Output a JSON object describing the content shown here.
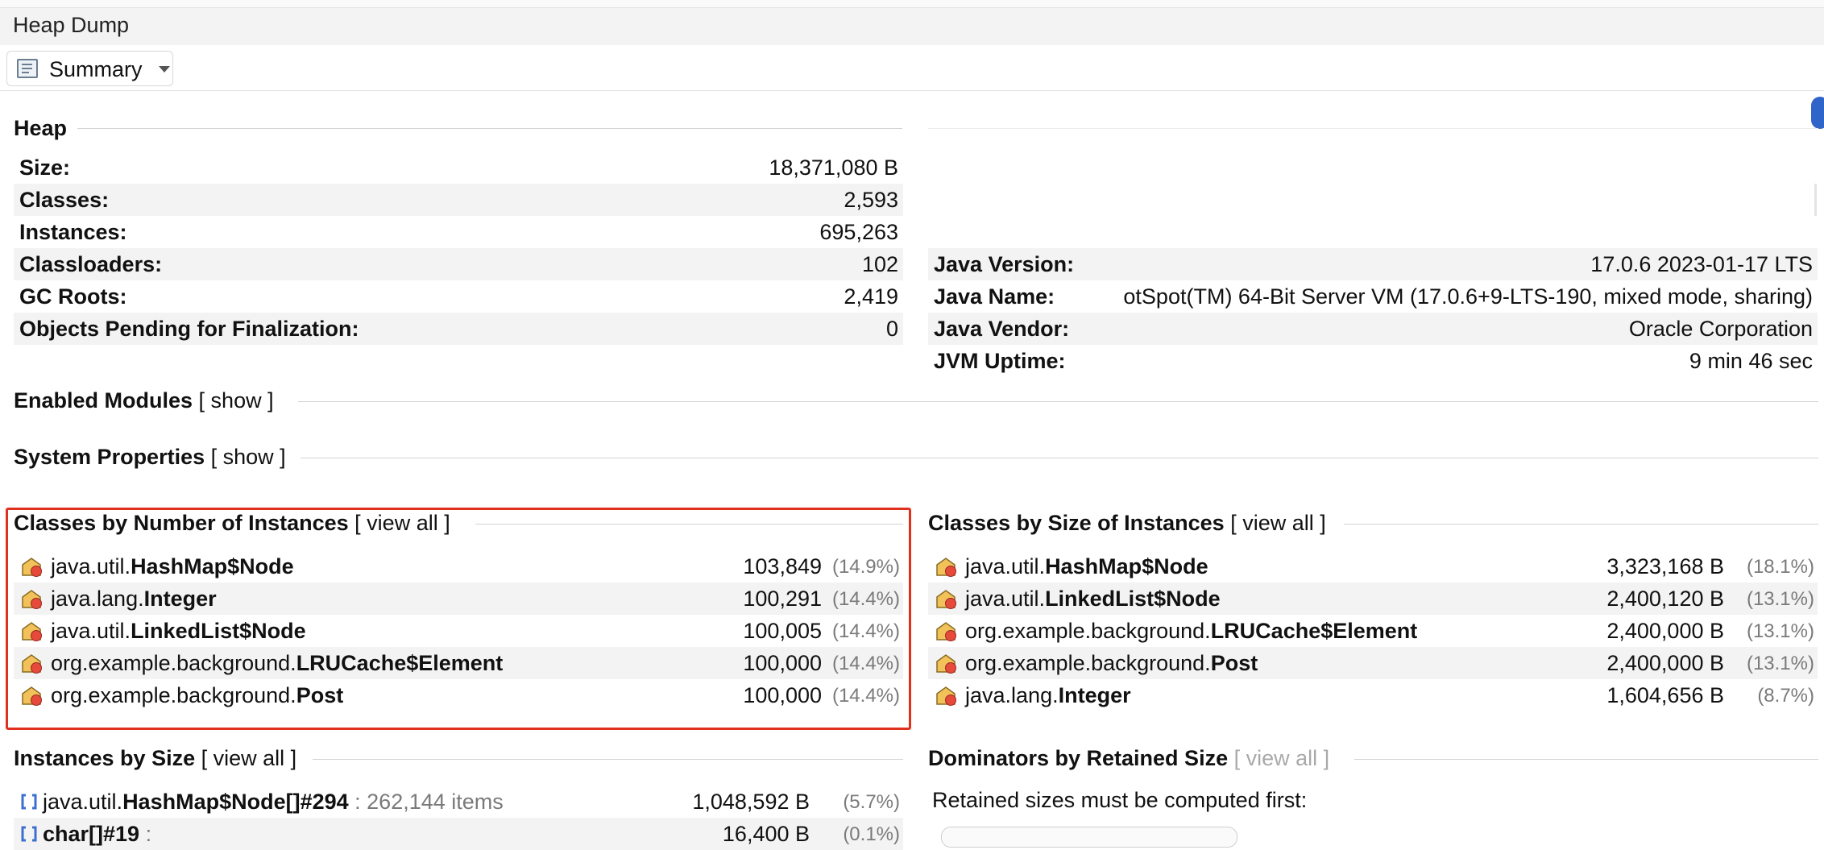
{
  "window": {
    "title": "Heap Dump"
  },
  "toolbar": {
    "view_label": "Summary",
    "view_icon": "document-icon"
  },
  "heap": {
    "title": "Heap",
    "rows": [
      {
        "label": "Size:",
        "value": "18,371,080 B"
      },
      {
        "label": "Classes:",
        "value": "2,593"
      },
      {
        "label": "Instances:",
        "value": "695,263"
      },
      {
        "label": "Classloaders:",
        "value": "102"
      },
      {
        "label": "GC Roots:",
        "value": "2,419"
      },
      {
        "label": "Objects Pending for Finalization:",
        "value": "0"
      }
    ]
  },
  "environment": {
    "rows": [
      {
        "label": "Java Version:",
        "value": "17.0.6 2023-01-17 LTS"
      },
      {
        "label": "Java Name:",
        "value": "otSpot(TM) 64-Bit Server VM (17.0.6+9-LTS-190, mixed mode, sharing)"
      },
      {
        "label": "Java Vendor:",
        "value": "Oracle Corporation"
      },
      {
        "label": "JVM Uptime:",
        "value": "9 min 46 sec"
      }
    ]
  },
  "modules": {
    "title": "Enabled Modules",
    "link": "[ show ]"
  },
  "properties": {
    "title": "System Properties",
    "link": "[ show ]"
  },
  "by_count": {
    "title": "Classes by Number of Instances",
    "link": "[ view all ]",
    "rows": [
      {
        "pkg": "java.util.",
        "cls": "HashMap$Node",
        "count": "103,849",
        "pct": "(14.9%)"
      },
      {
        "pkg": "java.lang.",
        "cls": "Integer",
        "count": "100,291",
        "pct": "(14.4%)"
      },
      {
        "pkg": "java.util.",
        "cls": "LinkedList$Node",
        "count": "100,005",
        "pct": "(14.4%)"
      },
      {
        "pkg": "org.example.background.",
        "cls": "LRUCache$Element",
        "count": "100,000",
        "pct": "(14.4%)"
      },
      {
        "pkg": "org.example.background.",
        "cls": "Post",
        "count": "100,000",
        "pct": "(14.4%)"
      }
    ]
  },
  "by_size": {
    "title": "Classes by Size of Instances",
    "link": "[ view all ]",
    "rows": [
      {
        "pkg": "java.util.",
        "cls": "HashMap$Node",
        "size": "3,323,168 B",
        "pct": "(18.1%)"
      },
      {
        "pkg": "java.util.",
        "cls": "LinkedList$Node",
        "size": "2,400,120 B",
        "pct": "(13.1%)"
      },
      {
        "pkg": "org.example.background.",
        "cls": "LRUCache$Element",
        "size": "2,400,000 B",
        "pct": "(13.1%)"
      },
      {
        "pkg": "org.example.background.",
        "cls": "Post",
        "size": "2,400,000 B",
        "pct": "(13.1%)"
      },
      {
        "pkg": "java.lang.",
        "cls": "Integer",
        "size": "1,604,656 B",
        "pct": "(8.7%)"
      }
    ]
  },
  "instances": {
    "title": "Instances by Size",
    "link": "[ view all ]",
    "rows": [
      {
        "pkg": "java.util.",
        "cls": "HashMap$Node[]#294",
        "items": " : 262,144 items",
        "size": "1,048,592 B",
        "pct": "(5.7%)"
      },
      {
        "pkg": "",
        "cls": "char[]#19",
        "items": " : ",
        "size": "16,400 B",
        "pct": "(0.1%)"
      }
    ]
  },
  "dominators": {
    "title": "Dominators by Retained Size",
    "link": "[ view all ]",
    "info": "Retained sizes must be computed first:"
  }
}
